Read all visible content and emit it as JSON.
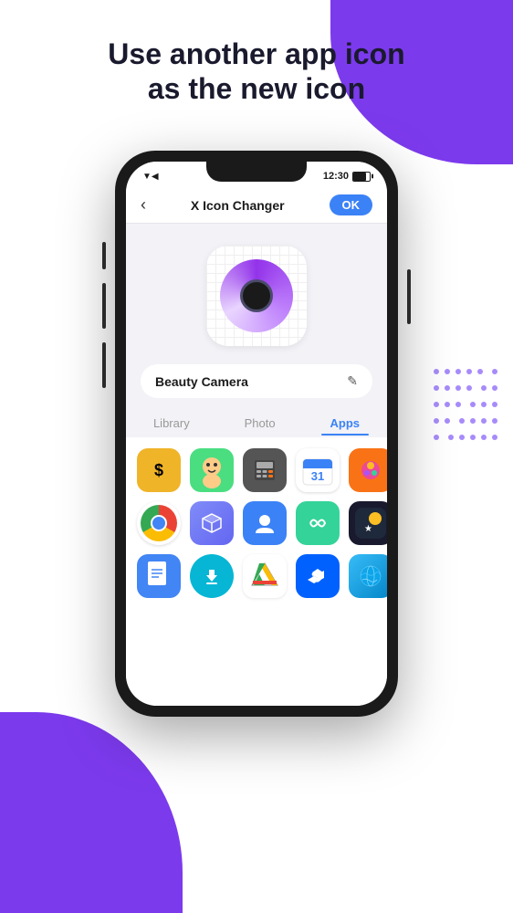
{
  "page": {
    "title_line1": "Use another app icon",
    "title_line2": "as the new icon",
    "background_color": "#ffffff",
    "accent_color": "#7c3aed"
  },
  "status_bar": {
    "time": "12:30",
    "signal": "▼◀",
    "battery_label": "battery"
  },
  "nav": {
    "back_label": "‹",
    "title": "X Icon Changer",
    "ok_label": "OK"
  },
  "icon_preview": {
    "app_name": "Beauty Camera",
    "edit_icon": "✎"
  },
  "tabs": [
    {
      "id": "library",
      "label": "Library",
      "active": false
    },
    {
      "id": "photo",
      "label": "Photo",
      "active": false
    },
    {
      "id": "apps",
      "label": "Apps",
      "active": true
    }
  ],
  "apps": [
    {
      "id": "cashapp",
      "color": "#f0b429",
      "symbol": "$",
      "text_color": "#000"
    },
    {
      "id": "bitmoji",
      "color": "#22c55e",
      "symbol": "😊",
      "text_color": "#fff"
    },
    {
      "id": "calculator",
      "color": "#6b7280",
      "symbol": "#",
      "text_color": "#fff"
    },
    {
      "id": "calendar",
      "color": "#3b82f6",
      "symbol": "31",
      "text_color": "#fff"
    },
    {
      "id": "candy-crush",
      "color": "#f97316",
      "symbol": "🍬",
      "text_color": "#fff"
    },
    {
      "id": "chrome",
      "color": "chrome",
      "symbol": "",
      "text_color": "#fff"
    },
    {
      "id": "tasks",
      "color": "#818cf8",
      "symbol": "◆",
      "text_color": "#fff"
    },
    {
      "id": "contacts",
      "color": "#3b82f6",
      "symbol": "👤",
      "text_color": "#fff"
    },
    {
      "id": "anagram",
      "color": "#34d399",
      "symbol": "∞",
      "text_color": "#fff"
    },
    {
      "id": "superstar",
      "color": "#f59e0b",
      "symbol": "★",
      "text_color": "#fff"
    },
    {
      "id": "docs",
      "color": "#4285f4",
      "symbol": "≡",
      "text_color": "#fff"
    },
    {
      "id": "downloader",
      "color": "#06b6d4",
      "symbol": "↓",
      "text_color": "#fff"
    },
    {
      "id": "drive",
      "color": "drive",
      "symbol": "",
      "text_color": "#fff"
    },
    {
      "id": "dropbox",
      "color": "#0ea5e9",
      "symbol": "◇",
      "text_color": "#fff"
    },
    {
      "id": "earth",
      "color": "#38bdf8",
      "symbol": "◎",
      "text_color": "#fff"
    }
  ]
}
